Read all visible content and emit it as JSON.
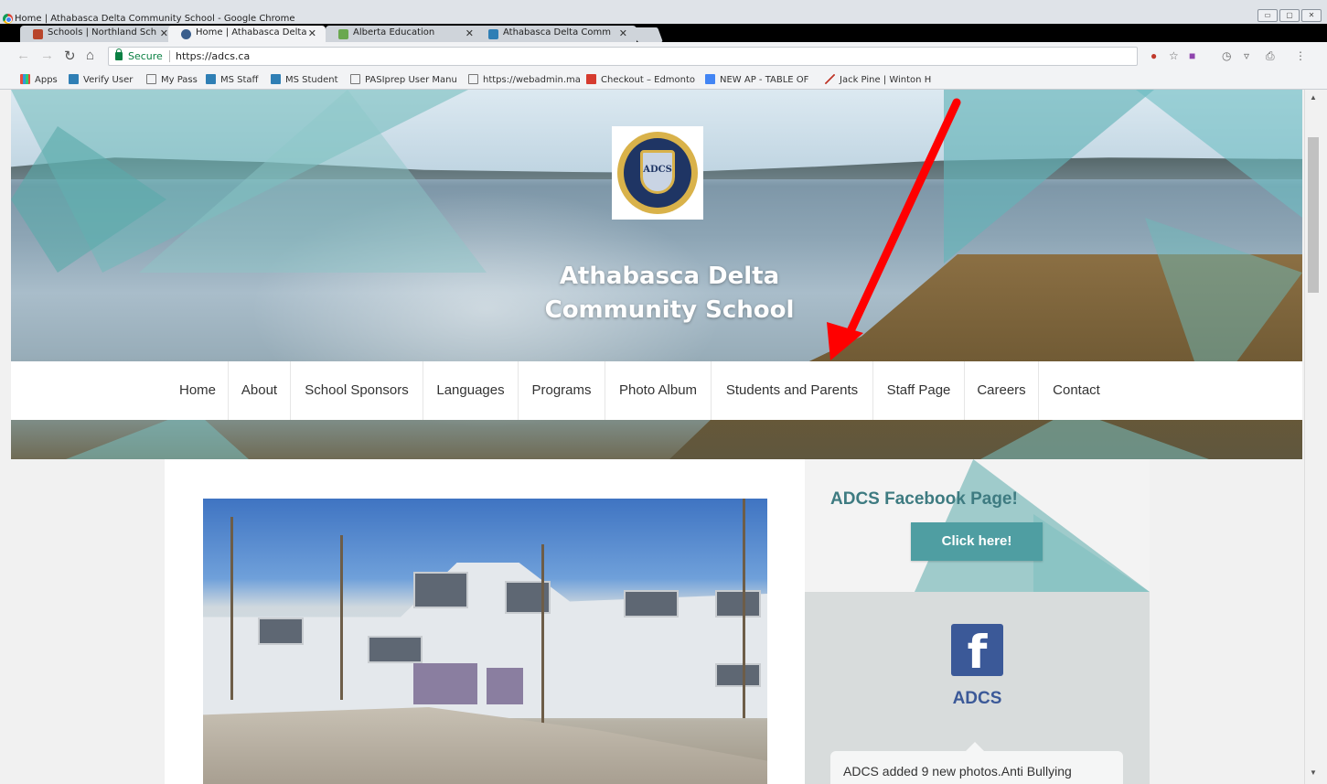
{
  "browser": {
    "window_title": "Home | Athabasca Delta Community School - Google Chrome",
    "tabs": [
      {
        "label": "Schools | Northland Sch",
        "active": false
      },
      {
        "label": "Home | Athabasca Delta",
        "active": true
      },
      {
        "label": "Alberta Education",
        "active": false
      },
      {
        "label": "Athabasca Delta Comm",
        "active": false
      }
    ],
    "secure_label": "Secure",
    "url": "https://adcs.ca",
    "bookmarks": [
      "Apps",
      "Verify User",
      "My Pass",
      "MS Staff",
      "MS Student",
      "PASIprep User Manu",
      "https://webadmin.ma",
      "Checkout – Edmonto",
      "NEW AP - TABLE OF",
      "Jack Pine | Winton H"
    ]
  },
  "site": {
    "school_name": "Athabasca Delta Community School",
    "logo_text": "ADCS",
    "nav": [
      "Home",
      "About",
      "School Sponsors",
      "Languages",
      "Programs",
      "Photo Album",
      "Students and Parents",
      "Staff Page",
      "Careers",
      "Contact"
    ]
  },
  "sidebar": {
    "heading": "ADCS Facebook Page!",
    "button_label": "Click here!",
    "fb_icon_glyph": "f",
    "fb_page_name": "ADCS",
    "post_preview": "ADCS added 9 new photos.Anti Bullying"
  },
  "colors": {
    "accent_teal": "#4f9ea2",
    "heading_teal": "#3e7b81",
    "facebook_blue": "#3b5998",
    "annotation_arrow": "#ff0000"
  },
  "icons": [
    "chrome-logo-icon",
    "lock-icon",
    "back-icon",
    "forward-icon",
    "reload-icon",
    "home-icon",
    "star-icon",
    "menu-icon",
    "facebook-icon",
    "annotation-arrow"
  ]
}
